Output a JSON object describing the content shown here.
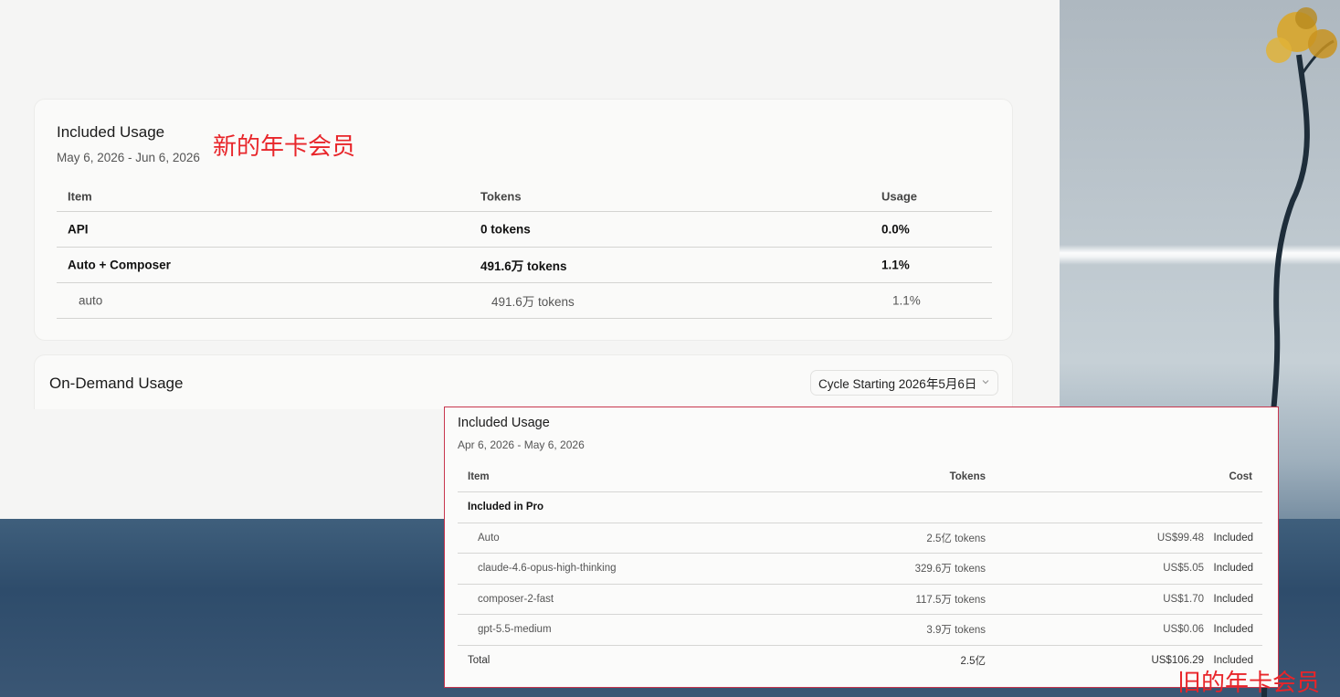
{
  "current_window": {
    "included_usage": {
      "title": "Included Usage",
      "period": "May 6, 2026 - Jun 6, 2026",
      "columns": [
        "Item",
        "Tokens",
        "Usage"
      ],
      "rows": [
        {
          "item": "API",
          "tokens": "0 tokens",
          "usage": "0.0%",
          "style": "bold"
        },
        {
          "item": "Auto + Composer",
          "tokens": "491.6万 tokens",
          "usage": "1.1%",
          "style": "bold"
        },
        {
          "item": "auto",
          "tokens": "491.6万 tokens",
          "usage": "1.1%",
          "style": "sub"
        }
      ]
    },
    "on_demand": {
      "title": "On-Demand Usage",
      "cycle_select_value": "Cycle Starting 2026年5月6日"
    }
  },
  "annotations": {
    "new_label": "新的年卡会员",
    "old_label": "旧的年卡会员"
  },
  "old_screenshot": {
    "title": "Included Usage",
    "period": "Apr 6, 2026 - May 6, 2026",
    "columns": [
      "Item",
      "Tokens",
      "Cost"
    ],
    "group_label": "Included in Pro",
    "rows": [
      {
        "item": "Auto",
        "tokens": "2.5亿 tokens",
        "cost": "US$99.48",
        "status": "Included"
      },
      {
        "item": "claude-4.6-opus-high-thinking",
        "tokens": "329.6万 tokens",
        "cost": "US$5.05",
        "status": "Included"
      },
      {
        "item": "composer-2-fast",
        "tokens": "117.5万 tokens",
        "cost": "US$1.70",
        "status": "Included"
      },
      {
        "item": "gpt-5.5-medium",
        "tokens": "3.9万 tokens",
        "cost": "US$0.06",
        "status": "Included"
      }
    ],
    "total": {
      "label": "Total",
      "tokens": "2.5亿",
      "cost": "US$106.29",
      "status": "Included"
    }
  },
  "colors": {
    "annotation_red": "#e8252a",
    "overlay_border": "#c8364e"
  }
}
